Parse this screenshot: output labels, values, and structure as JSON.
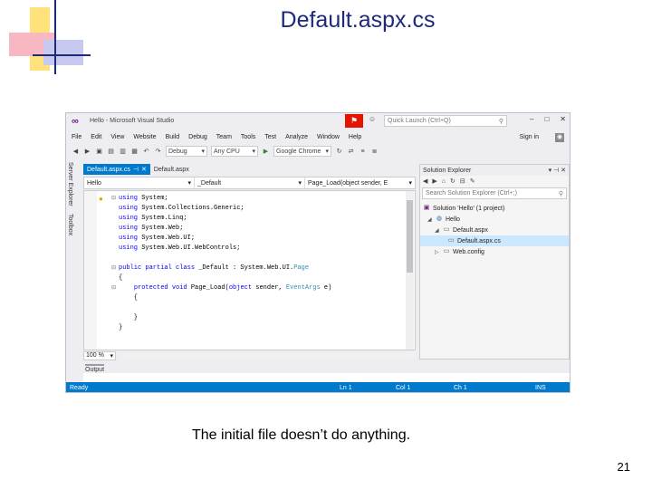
{
  "slide": {
    "title": "Default.aspx.cs",
    "caption": "The initial file doesn’t do anything.",
    "page_number": "21"
  },
  "window": {
    "title": "Hello - Microsoft Visual Studio",
    "quick_launch_placeholder": "Quick Launch (Ctrl+Q)",
    "minimize": "–",
    "maximize": "□",
    "close": "✕"
  },
  "menu": [
    "File",
    "Edit",
    "View",
    "Website",
    "Build",
    "Debug",
    "Team",
    "Tools",
    "Test",
    "Analyze",
    "Window",
    "Help"
  ],
  "sign_in": "Sign in",
  "toolbar": {
    "config": "Debug",
    "platform": "Any CPU",
    "browser": "Google Chrome"
  },
  "side_tabs": [
    "Server Explorer",
    "Toolbox"
  ],
  "editor": {
    "tabs": [
      {
        "label": "Default.aspx.cs",
        "active": true
      },
      {
        "label": "Default.aspx",
        "active": false
      }
    ],
    "nav": {
      "project": "Hello",
      "class": "_Default",
      "member": "Page_Load(object sender, E"
    },
    "code_lines": [
      {
        "kw": "using",
        "rest": " System;"
      },
      {
        "kw": "using",
        "rest": " System.Collections.Generic;"
      },
      {
        "kw": "using",
        "rest": " System.Linq;"
      },
      {
        "kw": "using",
        "rest": " System.Web;"
      },
      {
        "kw": "using",
        "rest": " System.Web.UI;"
      },
      {
        "kw": "using",
        "rest": " System.Web.UI.WebControls;"
      }
    ],
    "class_decl": {
      "kw": "public partial class",
      "name": " _Default : System.Web.UI.",
      "base": "Page"
    },
    "method_decl": {
      "kw": "protected void",
      "name": " Page_Load(",
      "p1_type": "object",
      "p1": " sender, ",
      "p2_type": "EventArgs",
      "p2": " e)"
    },
    "zoom": "100 %"
  },
  "output_tab": "Output",
  "solution_explorer": {
    "title": "Solution Explorer",
    "search_placeholder": "Search Solution Explorer (Ctrl+;)",
    "nodes": [
      {
        "label": "Solution 'Hello' (1 project)",
        "level": 0,
        "icon": "solution-icon"
      },
      {
        "label": "Hello",
        "level": 1,
        "icon": "website-icon"
      },
      {
        "label": "Default.aspx",
        "level": 2,
        "icon": "aspx-file-icon"
      },
      {
        "label": "Default.aspx.cs",
        "level": 3,
        "icon": "cs-file-icon"
      },
      {
        "label": "Web.config",
        "level": 2,
        "icon": "config-file-icon"
      }
    ]
  },
  "status": {
    "ready": "Ready",
    "ln": "Ln 1",
    "col": "Col 1",
    "ch": "Ch 1",
    "ins": "INS"
  }
}
